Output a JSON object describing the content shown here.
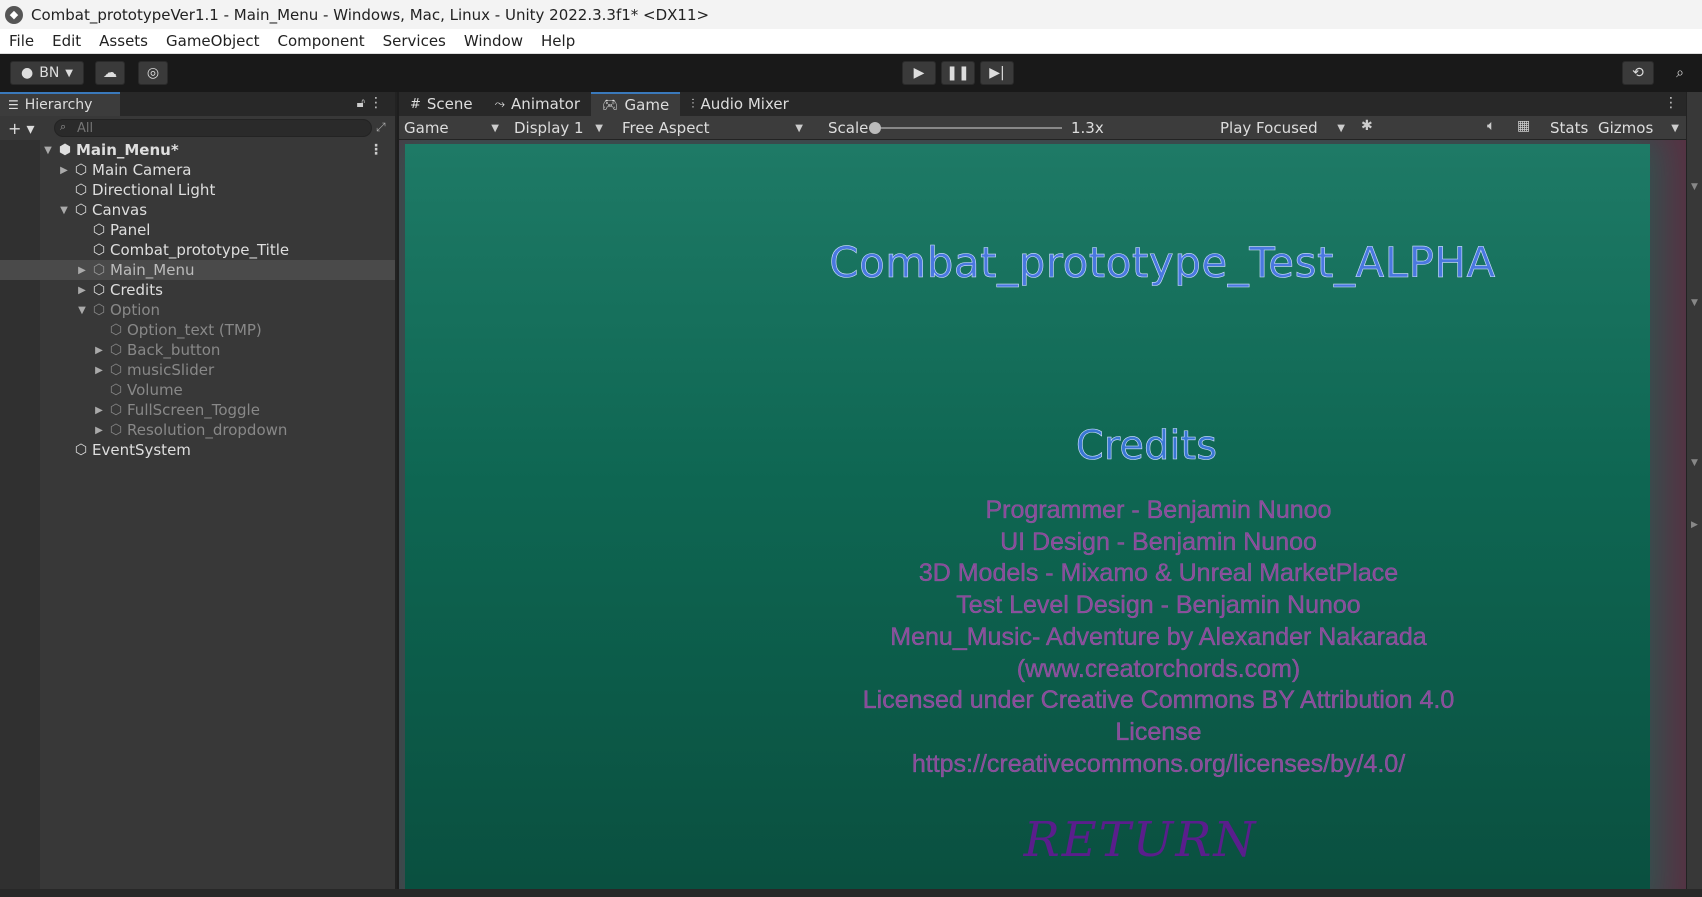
{
  "window": {
    "title": "Combat_prototypeVer1.1 - Main_Menu - Windows, Mac, Linux - Unity 2022.3.3f1* <DX11>"
  },
  "menu": [
    "File",
    "Edit",
    "Assets",
    "GameObject",
    "Component",
    "Services",
    "Window",
    "Help"
  ],
  "toolbar": {
    "account_label": "BN"
  },
  "hierarchy": {
    "tab_label": "Hierarchy",
    "search_placeholder": "All",
    "items": [
      {
        "label": "Main_Menu*"
      },
      {
        "label": "Main Camera"
      },
      {
        "label": "Directional Light"
      },
      {
        "label": "Canvas"
      },
      {
        "label": "Panel"
      },
      {
        "label": "Combat_prototype_Title"
      },
      {
        "label": "Main_Menu"
      },
      {
        "label": "Credits"
      },
      {
        "label": "Option"
      },
      {
        "label": "Option_text (TMP)"
      },
      {
        "label": "Back_button"
      },
      {
        "label": "musicSlider"
      },
      {
        "label": "Volume"
      },
      {
        "label": "FullScreen_Toggle"
      },
      {
        "label": "Resolution_dropdown"
      },
      {
        "label": "EventSystem"
      }
    ]
  },
  "game_view": {
    "tabs": [
      "Scene",
      "Animator",
      "Game",
      "Audio Mixer"
    ],
    "active_tab": "Game",
    "mode": "Game",
    "display": "Display 1",
    "aspect": "Free Aspect",
    "scale_label": "Scale",
    "scale_value": "1.3x",
    "play_mode": "Play Focused",
    "stats_label": "Stats",
    "gizmos_label": "Gizmos",
    "content": {
      "title": "Combat_prototype_Test_ALPHA",
      "credits_heading": "Credits",
      "credit_lines": [
        "Programmer - Benjamin Nunoo",
        "UI Design - Benjamin Nunoo",
        "3D Models - Mixamo & Unreal MarketPlace",
        "Test Level  Design - Benjamin Nunoo",
        "Menu_Music- Adventure by Alexander Nakarada",
        "(www.creatorchords.com)",
        "Licensed under Creative Commons BY Attribution 4.0",
        "License",
        "https://creativecommons.org/licenses/by/4.0/"
      ],
      "return_label": "RETURN"
    }
  },
  "colors": {
    "panel_bg": "#0e6652",
    "viewport_border": "#5a2f42",
    "title_text": "#4a78e0",
    "credits_text": "#8a4a9a",
    "return_text": "#5a1e8c"
  }
}
